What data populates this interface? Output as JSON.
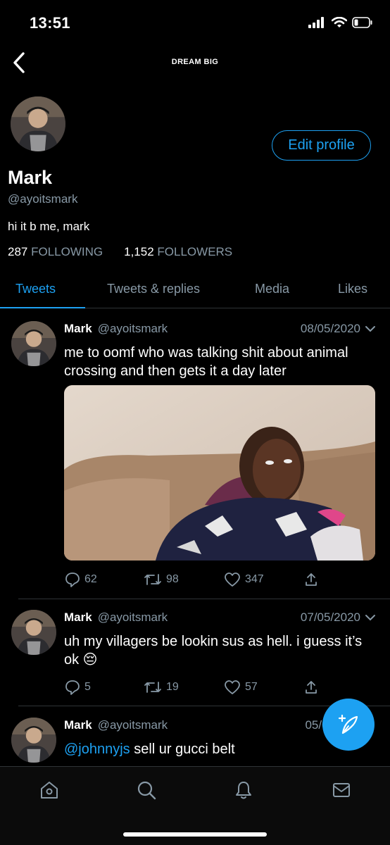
{
  "status": {
    "time": "13:51"
  },
  "header": {
    "title": "DREAM BIG"
  },
  "profile": {
    "name": "Mark",
    "handle": "@ayoitsmark",
    "bio": "hi it b me, mark",
    "following_count": "287",
    "following_label": "FOLLOWING",
    "followers_count": "1,152",
    "followers_label": "FOLLOWERS",
    "edit_label": "Edit profile"
  },
  "tabs": [
    {
      "label": "Tweets",
      "active": true
    },
    {
      "label": "Tweets & replies",
      "active": false
    },
    {
      "label": "Media",
      "active": false
    },
    {
      "label": "Likes",
      "active": false
    }
  ],
  "tweets": [
    {
      "name": "Mark",
      "handle": "@ayoitsmark",
      "date": "08/05/2020",
      "text": "me to oomf who was talking shit about animal crossing and then gets it a day later",
      "replies": "62",
      "retweets": "98",
      "likes": "347"
    },
    {
      "name": "Mark",
      "handle": "@ayoitsmark",
      "date": "07/05/2020",
      "text": "uh my villagers be lookin sus as hell. i guess it’s ok 😔",
      "replies": "5",
      "retweets": "19",
      "likes": "57"
    },
    {
      "name": "Mark",
      "handle": "@ayoitsmark",
      "date": "05/05",
      "mention": "@johnnyjs",
      "text": " sell ur gucci belt"
    }
  ],
  "colors": {
    "accent": "#1da1f2",
    "muted": "#8899a6",
    "background": "#000000"
  },
  "icons": {
    "back": "chevron-left-icon",
    "reply": "reply-icon",
    "retweet": "retweet-icon",
    "like": "heart-icon",
    "share": "share-icon",
    "compose": "compose-icon",
    "nav": [
      "home-icon",
      "search-icon",
      "bell-icon",
      "mail-icon"
    ]
  }
}
